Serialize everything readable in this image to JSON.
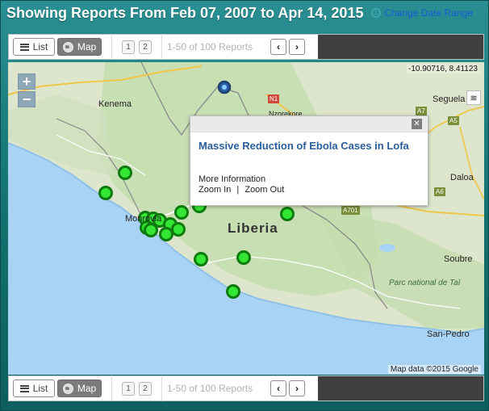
{
  "header": {
    "title": "Showing Reports From Feb 07, 2007 to Apr 14, 2015",
    "change_date_label": "Change Date Range",
    "icon": "clock-icon"
  },
  "toolbar": {
    "list_label": "List",
    "map_label": "Map",
    "pages": [
      "1",
      "2"
    ],
    "count_text": "1-50 of 100 Reports",
    "prev_symbol": "‹",
    "next_symbol": "›",
    "active_view": "Map"
  },
  "map": {
    "zoom_in": "+",
    "zoom_out": "−",
    "coords": "-10.90716, 8.41123",
    "country_label": "Liberia",
    "place_labels": [
      "Kenema",
      "Nzorekore",
      "Seguela",
      "Daloa",
      "Monrovia",
      "Soubre",
      "Parc national de Taï",
      "San-Pedro"
    ],
    "roads": [
      "N1",
      "A5",
      "A6",
      "A7",
      "A701"
    ],
    "attribution": "Map data ©2015 Google",
    "marker_color": "#33e633"
  },
  "popup": {
    "title": "Massive Reduction of Ebola Cases in Lofa",
    "more_info": "More Information",
    "zoom_in_link": "Zoom In",
    "separator": "|",
    "zoom_out_link": "Zoom Out"
  },
  "colors": {
    "frame": "#1d7d80",
    "header_text": "#ffffff",
    "link": "#1a5bd6",
    "popup_title": "#2a5e9c",
    "ocean": "#a9d3f5",
    "land": "#dfe7cf"
  }
}
